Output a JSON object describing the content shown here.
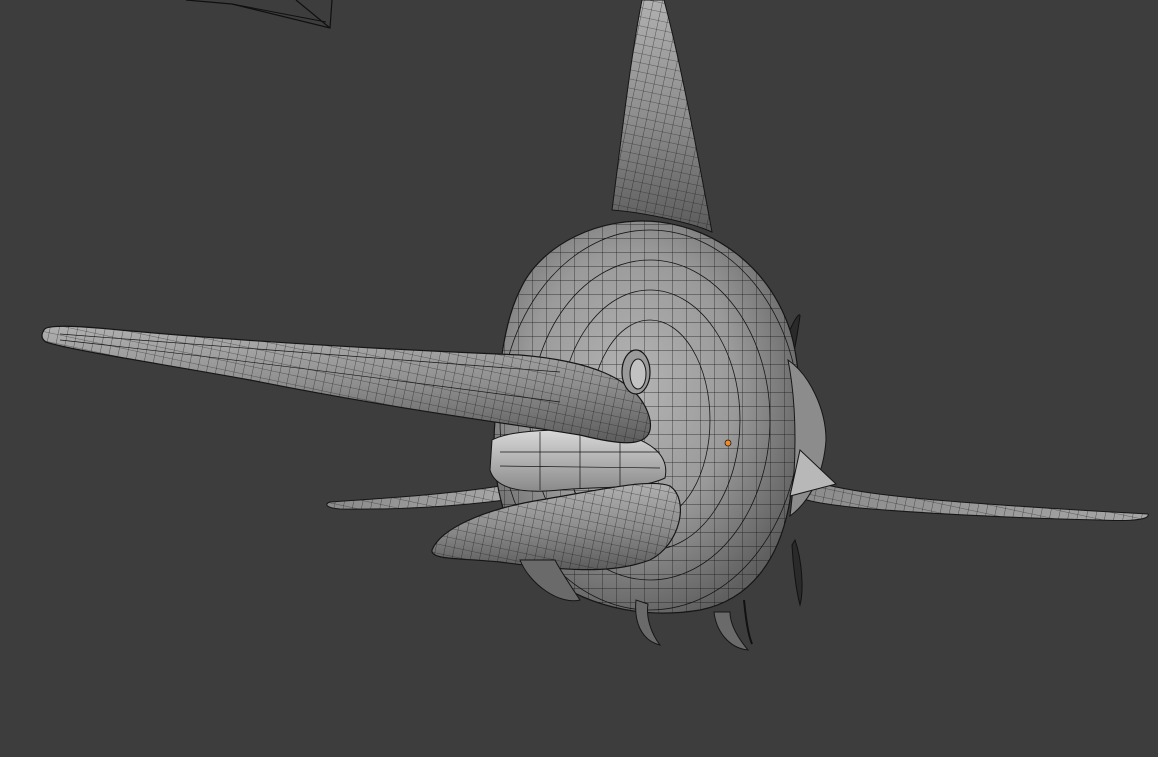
{
  "viewport": {
    "background": "#3d3d3d",
    "object_shading": "#9c9c9c",
    "wireframe_color": "#161616",
    "origin_color": "#f08a24"
  },
  "scene": {
    "object": "swordfish-mesh",
    "overlay": "wireframe",
    "camera_object": "camera-frustum",
    "origin": "object-origin-dot"
  }
}
